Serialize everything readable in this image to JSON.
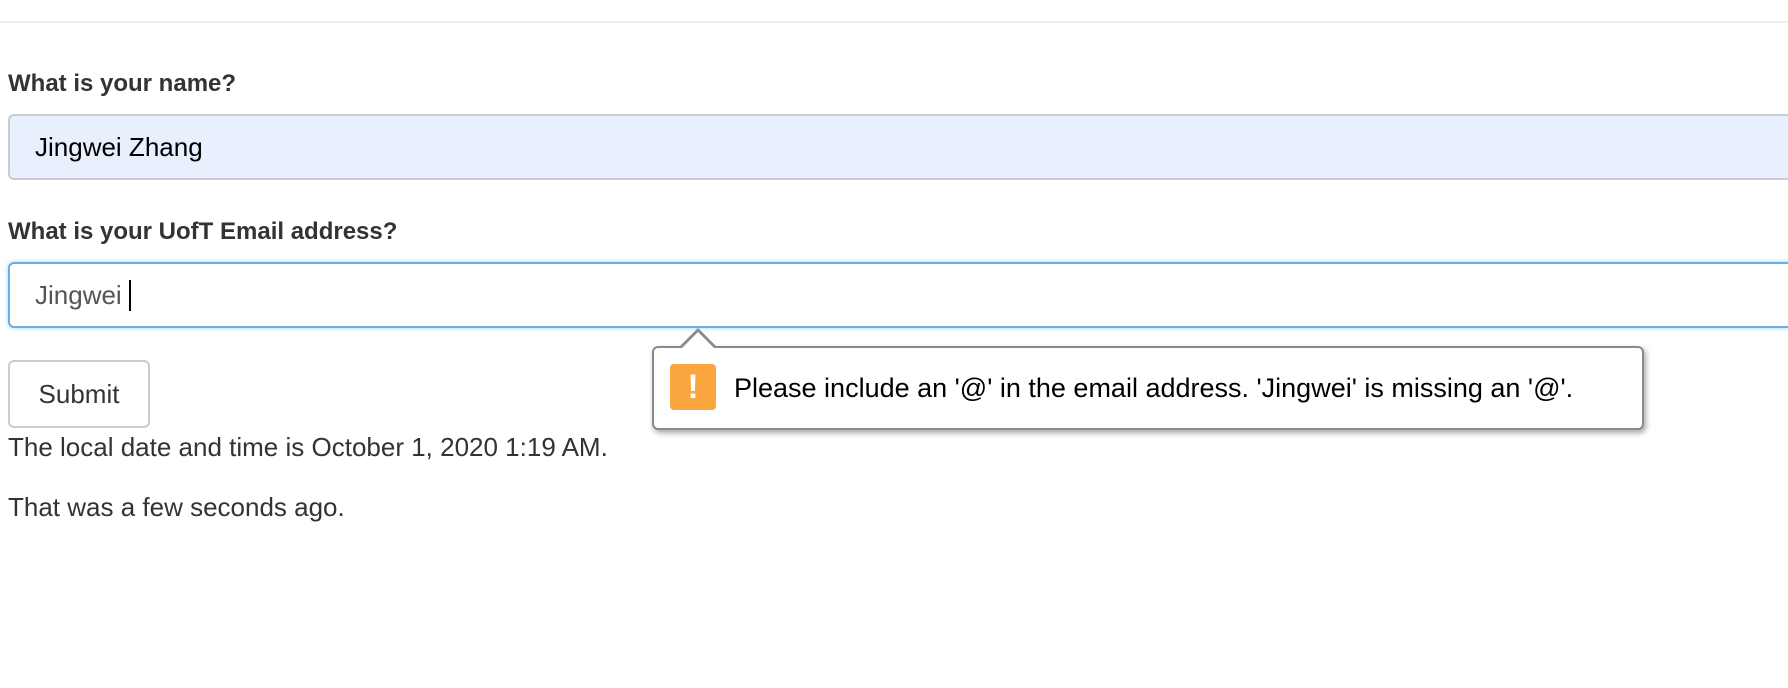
{
  "form": {
    "name_label": "What is your name?",
    "name_value": "Jingwei Zhang",
    "email_label": "What is your UofT Email address?",
    "email_value": "Jingwei",
    "submit_label": "Submit"
  },
  "info": {
    "datetime_text": "The local date and time is October 1, 2020 1:19 AM.",
    "ago_text": "That was a few seconds ago."
  },
  "validation_tooltip": {
    "icon": "warning-icon",
    "icon_glyph": "!",
    "message": "Please include an '@' in the email address. 'Jingwei' is missing an '@'.",
    "icon_color": "#f9a73e"
  },
  "colors": {
    "autofill_background": "#e8f0fe",
    "focus_border": "#66afe9",
    "text": "#333333"
  }
}
